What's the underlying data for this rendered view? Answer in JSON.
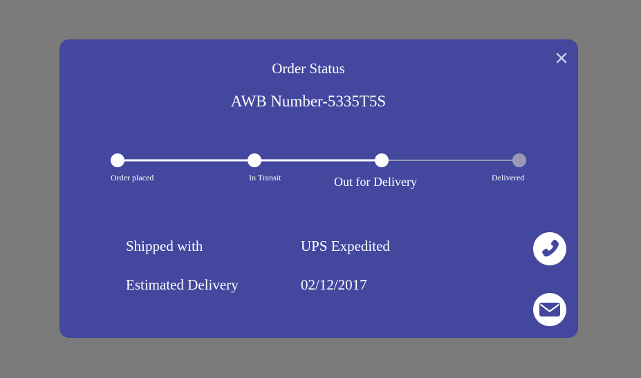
{
  "modal": {
    "title": "Order Status",
    "awb_label": "AWB Number-5335T5S",
    "close_icon": "close-icon"
  },
  "tracker": {
    "completed_color": "#ffffff",
    "pending_color": "#9a9ab4",
    "current_index": 2,
    "steps": [
      {
        "label": "Order placed",
        "done": true
      },
      {
        "label": "In Transit",
        "done": true
      },
      {
        "label": "Out for Delivery",
        "done": true
      },
      {
        "label": "Delivered",
        "done": false
      }
    ]
  },
  "details": {
    "shipped_with_label": "Shipped with",
    "shipped_with_value": "UPS Expedited",
    "estimated_delivery_label": "Estimated Delivery",
    "estimated_delivery_value": "02/12/2017"
  },
  "actions": {
    "phone_icon": "phone-icon",
    "mail_icon": "mail-icon"
  },
  "colors": {
    "backdrop": "#7b7b7b",
    "modal": "#43479e",
    "text": "#ffffff"
  }
}
